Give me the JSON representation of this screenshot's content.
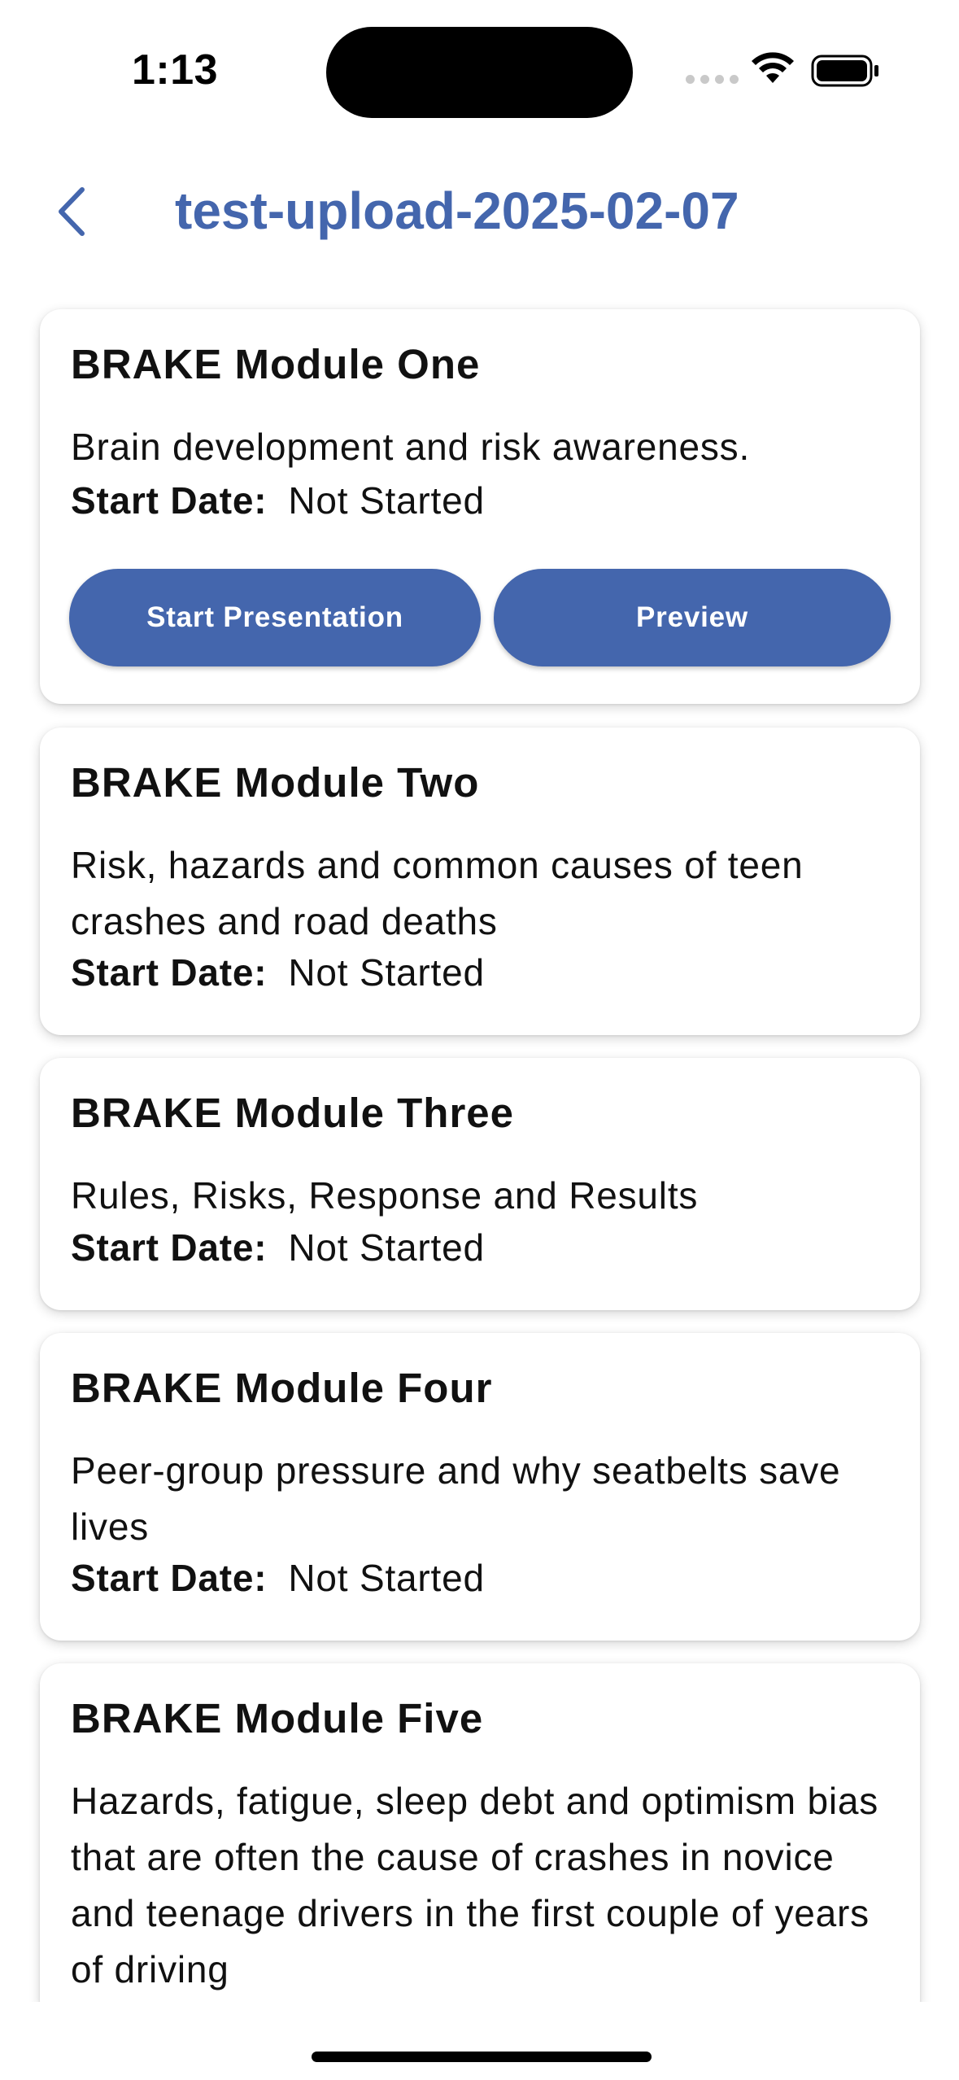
{
  "status_bar": {
    "time": "1:13"
  },
  "header": {
    "title": "test-upload-2025-02-07",
    "back_icon": "chevron-left-icon"
  },
  "theme": {
    "accent": "#4466ad",
    "text": "#111111",
    "background": "#ffffff"
  },
  "modules": [
    {
      "title": "BRAKE Module One",
      "description": "Brain development and risk awareness.",
      "start_label": "Start Date:",
      "start_value": "Not Started",
      "buttons": {
        "start_presentation": "Start Presentation",
        "preview": "Preview"
      }
    },
    {
      "title": "BRAKE Module Two",
      "description": "Risk, hazards and common causes of teen crashes and road deaths",
      "start_label": "Start Date:",
      "start_value": "Not Started"
    },
    {
      "title": "BRAKE Module Three",
      "description": "Rules, Risks, Response and Results",
      "start_label": "Start Date:",
      "start_value": "Not Started"
    },
    {
      "title": "BRAKE Module Four",
      "description": "Peer-group pressure and why seatbelts save lives",
      "start_label": "Start Date:",
      "start_value": "Not Started"
    },
    {
      "title": "BRAKE Module Five",
      "description": "Hazards, fatigue, sleep debt and optimism bias that are often the cause of crashes in novice and teenage drivers in the first couple of years of driving"
    }
  ]
}
